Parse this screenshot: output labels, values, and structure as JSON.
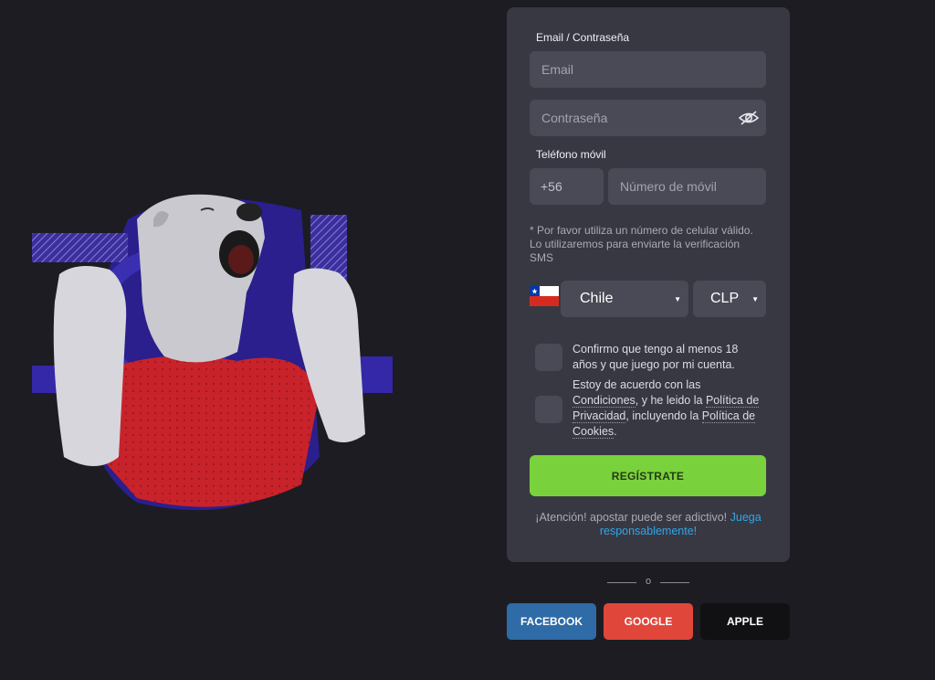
{
  "colors": {
    "background": "#1c1c22",
    "card": "#383843",
    "field": "#4a4a57",
    "accent_green": "#79d23b",
    "facebook": "#2f6ba6",
    "google": "#e0473a",
    "apple": "#111114",
    "link_blue": "#2ea7e8"
  },
  "form": {
    "email_section_label": "Email / Contraseña",
    "email_placeholder": "Email",
    "password_placeholder": "Contraseña",
    "password_icon": "eye-slash-icon",
    "phone_section_label": "Teléfono móvil",
    "phone_prefix": "+56",
    "phone_placeholder": "Número de móvil",
    "phone_hint": "* Por favor utiliza un número de celular válido. Lo utilizaremos para enviarte la verificación SMS",
    "country_flag": "chile-flag-icon",
    "country": "Chile",
    "currency": "CLP",
    "age_confirm": "Confirmo que tengo al menos 18 años y que juego por mi cuenta.",
    "terms": {
      "prefix": "Estoy de acuerdo con las ",
      "conditions_link": "Condiciones",
      "middle": ", y he leido la ",
      "privacy_link": "Política de Privacidad",
      "middle2": ", incluyendo la ",
      "cookies_link": "Política de Cookies",
      "suffix": "."
    },
    "submit_label": "REGÍSTRATE",
    "warning_text": "¡Atención! apostar puede ser adictivo! ",
    "warning_link": "Juega responsablemente!"
  },
  "divider_text": "o",
  "social": {
    "facebook": "FACEBOOK",
    "google": "GOOGLE",
    "apple": "APPLE"
  }
}
